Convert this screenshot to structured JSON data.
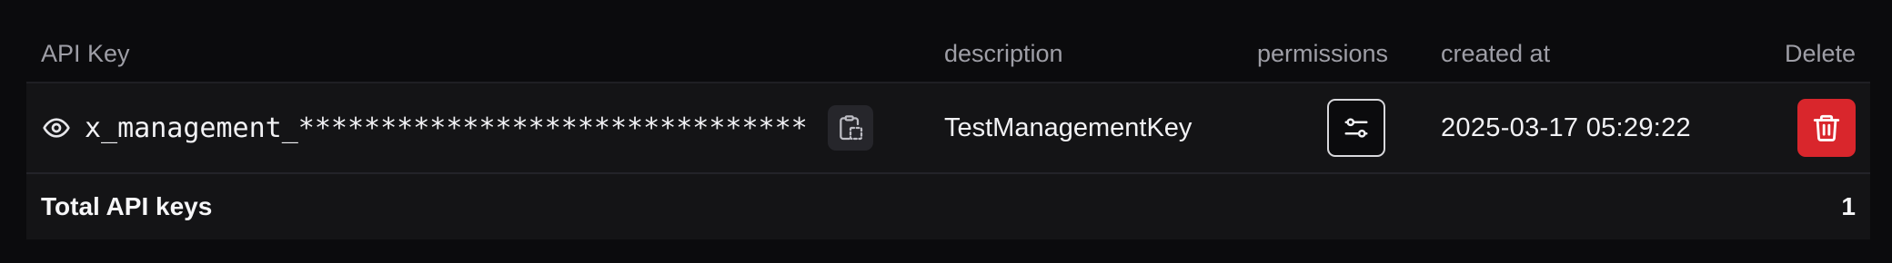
{
  "table": {
    "headers": {
      "api_key": "API Key",
      "description": "description",
      "permissions": "permissions",
      "created_at": "created at",
      "delete": "Delete"
    },
    "rows": [
      {
        "key_masked": "x_management_*******************************",
        "description": "TestManagementKey",
        "created_at": "2025-03-17 05:29:22",
        "icons": {
          "reveal": "eye-icon",
          "copy": "clipboard-icon",
          "permissions": "sliders-icon",
          "delete": "trash-icon"
        }
      }
    ],
    "footer": {
      "label": "Total API keys",
      "count": "1"
    }
  },
  "colors": {
    "background": "#0b0b0d",
    "row_background": "#141416",
    "header_text": "#9e9ea6",
    "delete_button": "#d9262c"
  }
}
